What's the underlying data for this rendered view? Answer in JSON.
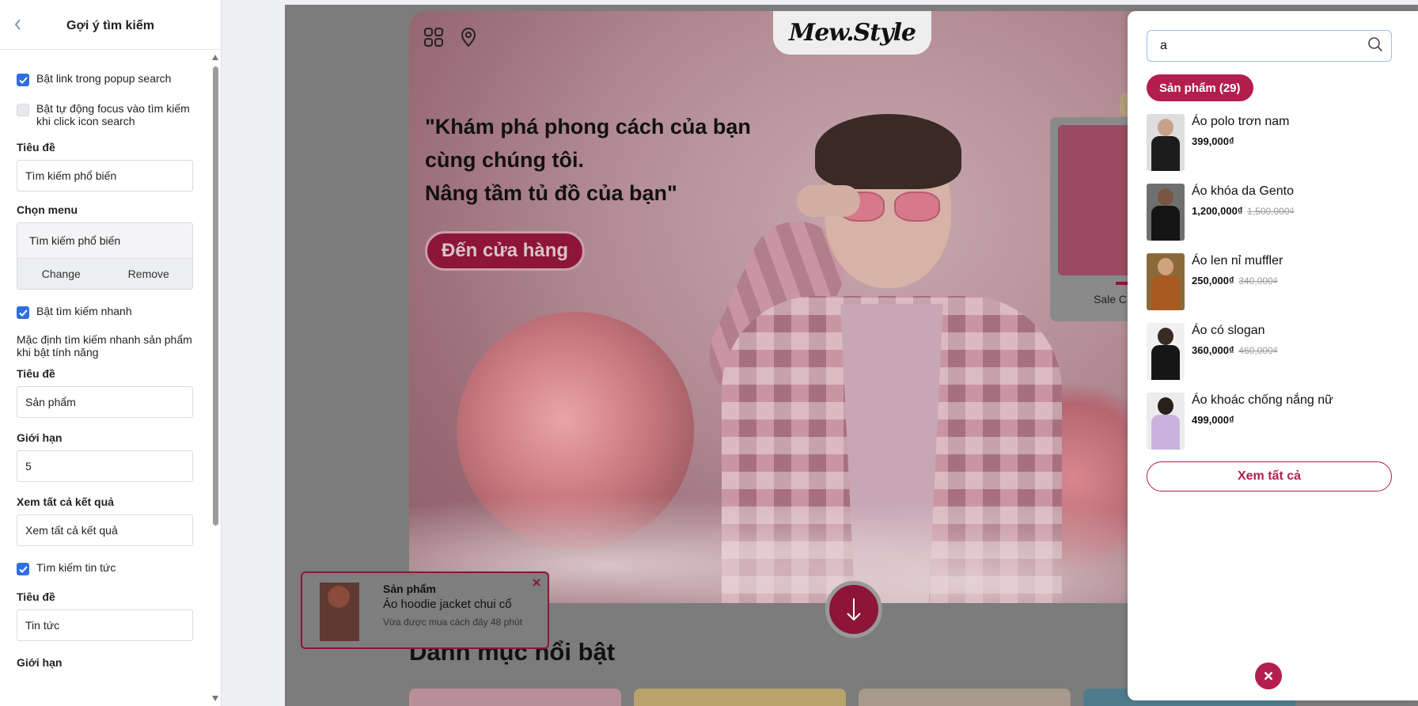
{
  "settings": {
    "header_title": "Gợi ý tìm kiếm",
    "popup_link_label": "Bật link trong popup search",
    "autofocus_label": "Bật tự động focus vào tìm kiếm khi click icon search",
    "title_label": "Tiêu đề",
    "title_value": "Tìm kiếm phổ biến",
    "menu_label": "Chọn menu",
    "menu_value": "Tìm kiếm phổ biến",
    "menu_change": "Change",
    "menu_remove": "Remove",
    "quick_search_label": "Bật tìm kiếm nhanh",
    "quick_search_help": "Mặc định tìm kiếm nhanh sản phẩm khi bật tính năng",
    "product_title_label": "Tiêu đề",
    "product_title_value": "Sản phẩm",
    "limit_label": "Giới hạn",
    "limit_value": "5",
    "see_all_label": "Xem tất cả kết quả",
    "see_all_value": "Xem tất cả kết quả",
    "news_search_label": "Tìm kiếm tin tức",
    "news_title_label": "Tiêu đề",
    "news_title_value": "Tin tức",
    "news_limit_label": "Giới hạn"
  },
  "store": {
    "logo": "Mew.Style",
    "tagline_1": "\"Khám phá phong cách của bạn",
    "tagline_2": "cùng chúng tôi.",
    "tagline_3": "Nâng tầm tủ đồ của bạn\"",
    "shop_button": "Đến cửa hàng",
    "card_caption": "Sale C",
    "section_title": "Danh mục nổi bật"
  },
  "toast": {
    "title": "Sản phẩm",
    "product": "Áo hoodie jacket chui cổ",
    "time": "Vừa được mua cách đây 48 phút"
  },
  "search": {
    "query": "a",
    "tab_label": "Sản phẩm (29)",
    "see_all": "Xem tất cả",
    "results": [
      {
        "name": "Áo polo trơn nam",
        "price": "399,000₫",
        "old_price": ""
      },
      {
        "name": "Áo khóa da Gento",
        "price": "1,200,000₫",
        "old_price": "1,500,000₫"
      },
      {
        "name": "Áo len nỉ muffler",
        "price": "250,000₫",
        "old_price": "340,000₫"
      },
      {
        "name": "Áo có slogan",
        "price": "360,000₫",
        "old_price": "460,000₫"
      },
      {
        "name": "Áo khoác chống nắng nữ",
        "price": "499,000₫",
        "old_price": ""
      }
    ]
  },
  "colors": {
    "accent": "#b31e4e",
    "checkbox": "#2f6fe4"
  }
}
